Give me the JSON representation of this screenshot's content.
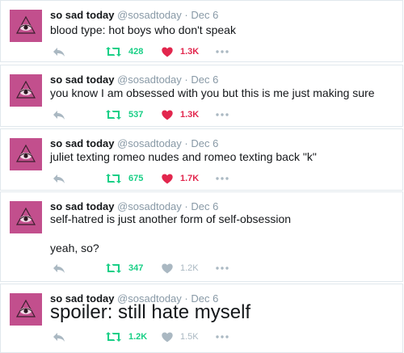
{
  "colors": {
    "retweet": "#19cf86",
    "like_on": "#e2264d",
    "like_off": "#aab8c2",
    "icon_gray": "#aab8c2",
    "avatar_bg": "#c24f8d"
  },
  "tweets": [
    {
      "name": "so sad today",
      "handle": "@sosadtoday",
      "sep": "·",
      "date": "Dec 6",
      "text": "blood type: hot boys who don't speak",
      "text2": "",
      "retweets": "428",
      "likes": "1.3K",
      "liked": true
    },
    {
      "name": "so sad today",
      "handle": "@sosadtoday",
      "sep": "·",
      "date": "Dec 6",
      "text": "you know I am obsessed with you but this is me just making sure",
      "text2": "",
      "retweets": "537",
      "likes": "1.3K",
      "liked": true
    },
    {
      "name": "so sad today",
      "handle": "@sosadtoday",
      "sep": "·",
      "date": "Dec 6",
      "text": "juliet texting romeo nudes and romeo texting back \"k\"",
      "text2": "",
      "retweets": "675",
      "likes": "1.7K",
      "liked": true
    },
    {
      "name": "so sad today",
      "handle": "@sosadtoday",
      "sep": "·",
      "date": "Dec 6",
      "text": "self-hatred is just another form of self-obsession",
      "text2": "yeah, so?",
      "retweets": "347",
      "likes": "1.2K",
      "liked": false
    },
    {
      "name": "so sad today",
      "handle": "@sosadtoday",
      "sep": "·",
      "date": "Dec 6",
      "text": "spoiler: still hate myself",
      "text2": "",
      "retweets": "1.2K",
      "likes": "1.5K",
      "liked": false
    }
  ]
}
